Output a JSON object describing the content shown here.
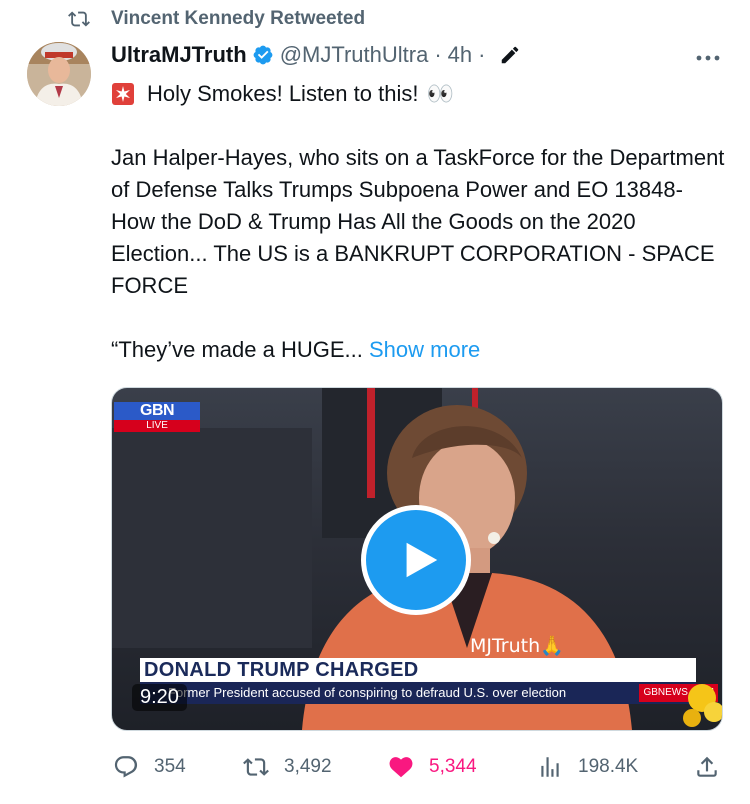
{
  "retweet": {
    "label": "Vincent Kennedy Retweeted",
    "icon": "retweet-icon"
  },
  "author": {
    "display_name": "UltraMJTruth",
    "handle": "@MJTruthUltra",
    "separator": "·",
    "time": "4h",
    "verified": true,
    "avatar": "avatar-photo"
  },
  "icons": {
    "more": "more-icon",
    "edit": "edit-icon",
    "siren": "siren-emoji",
    "verified": "verified-badge-icon"
  },
  "tweet": {
    "line1": "Holy Smokes! Listen to this!",
    "eyes": "👀",
    "para2": "Jan Halper-Hayes, who sits on a TaskForce for the Department of Defense Talks Trumps Subpoena Power and EO 13848- How the DoD & Trump Has All the Goods on the 2020 Election... The US is a BANKRUPT CORPORATION - SPACE FORCE",
    "para3": "“They’ve made a HUGE...",
    "show_more": "Show more"
  },
  "media": {
    "duration": "9:20",
    "logo": "GBN",
    "live_label": "LIVE",
    "headline": "DONALD TRUMP CHARGED",
    "subline": "Former President accused of conspiring to defraud U.S. over election",
    "channel_url": "GBNEWS.COM",
    "watermark": "MJTruth🙏"
  },
  "actions": {
    "replies": "354",
    "retweets": "3,492",
    "likes": "5,344",
    "views": "198.4K"
  },
  "colors": {
    "accent": "#1d9bf0",
    "like": "#f91880",
    "muted": "#536471",
    "text": "#0f1419"
  }
}
